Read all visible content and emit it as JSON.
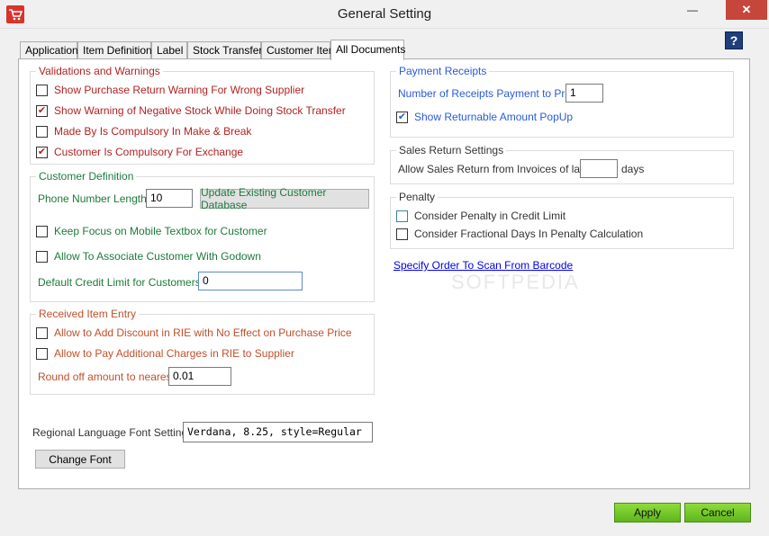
{
  "window": {
    "title": "General Setting",
    "close_glyph": "✕",
    "min_glyph": "—",
    "max_glyph": "☐"
  },
  "help": {
    "label": "?"
  },
  "tabs": [
    {
      "label": "Application"
    },
    {
      "label": "Item Definition"
    },
    {
      "label": "Label"
    },
    {
      "label": "Stock Transfer"
    },
    {
      "label": "Customer Item"
    },
    {
      "label": "All Documents",
      "active": true
    }
  ],
  "validations": {
    "title": "Validations and Warnings",
    "items": [
      {
        "label": "Show Purchase Return Warning For Wrong Supplier",
        "checked": false
      },
      {
        "label": "Show Warning of Negative Stock While Doing Stock Transfer",
        "checked": true
      },
      {
        "label": "Made By Is Compulsory In Make & Break",
        "checked": false
      },
      {
        "label": "Customer Is Compulsory For Exchange",
        "checked": true
      }
    ]
  },
  "customer_definition": {
    "title": "Customer Definition",
    "phone_label": "Phone Number Length :",
    "phone_value": "10",
    "update_button": "Update Existing Customer Database",
    "keep_focus": {
      "label": "Keep Focus on Mobile Textbox for Customer",
      "checked": false
    },
    "associate": {
      "label": "Allow To Associate Customer With Godown",
      "checked": false
    },
    "credit_label": "Default Credit Limit  for Customers :",
    "credit_value": "0"
  },
  "received_item": {
    "title": "Received Item Entry",
    "discount": {
      "label": "Allow to Add Discount in RIE with No Effect on Purchase Price",
      "checked": false
    },
    "charges": {
      "label": "Allow to Pay Additional Charges in RIE to Supplier",
      "checked": false
    },
    "round_label": "Round off amount to nearest :",
    "round_value": "0.01"
  },
  "font_setting": {
    "label": "Regional Language Font Setting :",
    "value": "Verdana, 8.25, style=Regular",
    "button": "Change Font"
  },
  "payment_receipts": {
    "title": "Payment Receipts",
    "count_label": "Number of Receipts Payment to Print :",
    "count_value": "1",
    "show_amount": {
      "label": "Show Returnable Amount PopUp",
      "checked": true
    }
  },
  "sales_return": {
    "title": "Sales Return Settings",
    "label": "Allow Sales Return from Invoices of last :",
    "value": "",
    "unit": "days"
  },
  "penalty": {
    "title": "Penalty",
    "credit": {
      "label": "Consider Penalty in Credit Limit",
      "checked": false
    },
    "fractional": {
      "label": "Consider Fractional Days In Penalty Calculation",
      "checked": false
    }
  },
  "barcode_link": "Specify Order To Scan From Barcode",
  "watermark": "SOFTPEDIA",
  "footer": {
    "apply": "Apply",
    "cancel": "Cancel"
  },
  "colors": {
    "red_text": "#b22222",
    "green_text": "#1d7a3a",
    "blue_text": "#2a5bd7",
    "orange_text": "#c0502a",
    "button_green": "#7ed321",
    "close_red": "#c7463b"
  }
}
